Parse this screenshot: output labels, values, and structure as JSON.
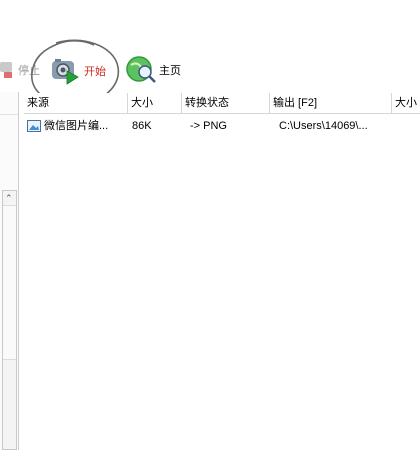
{
  "toolbar": {
    "stop_label": "停止",
    "start_label": "开始",
    "home_label": "主页"
  },
  "table": {
    "columns": [
      "来源",
      "大小",
      "转换状态",
      "输出 [F2]",
      "大小"
    ],
    "rows": [
      {
        "source": "微信图片编...",
        "size": "86K",
        "status": "-> PNG",
        "output": "C:\\Users\\14069\\..."
      }
    ]
  },
  "colors": {
    "start_text": "#cc2a1e",
    "home_globe": "#2e9b3a"
  }
}
